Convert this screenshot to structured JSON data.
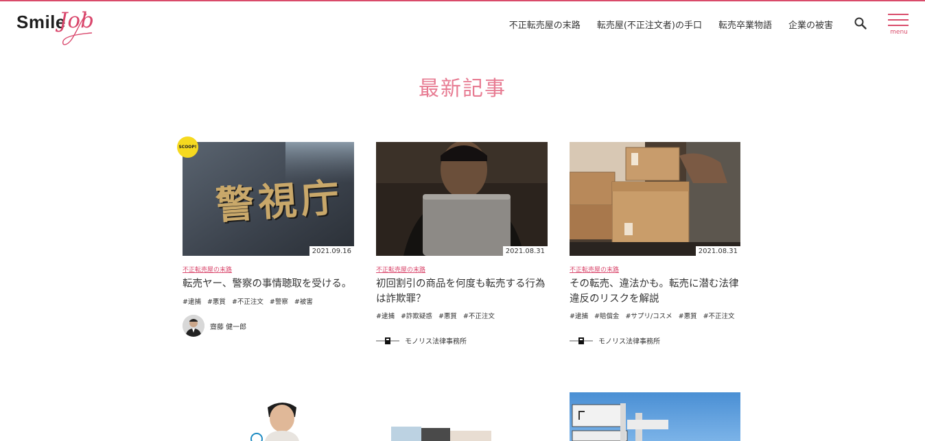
{
  "logo": {
    "text_main": "Smile",
    "text_script": "Job"
  },
  "nav": {
    "items": [
      "不正転売屋の末路",
      "転売屋(不正注文者)の手口",
      "転売卒業物語",
      "企業の被害"
    ],
    "menu_label": "menu",
    "search_icon": "search-icon"
  },
  "section_title": "最新記事",
  "scoop_badge": "SCOOP!",
  "colors": {
    "accent": "#d94b6a",
    "title_pink": "#e77b92"
  },
  "cards": [
    {
      "date": "2021.09.16",
      "category": "不正転売屋の末路",
      "title": "転売ヤー、警察の事情聴取を受ける。",
      "tags": [
        "#逮捕",
        "#悪質",
        "#不正注文",
        "#警察",
        "#被害"
      ],
      "author": "齋藤 健一郎",
      "image_text": "警視庁"
    },
    {
      "date": "2021.08.31",
      "category": "不正転売屋の末路",
      "title": "初回割引の商品を何度も転売する行為は詐欺罪？",
      "tags": [
        "#逮捕",
        "#詐欺疑惑",
        "#悪質",
        "#不正注文"
      ],
      "author": "モノリス法律事務所"
    },
    {
      "date": "2021.08.31",
      "category": "不正転売屋の末路",
      "title": "その転売、違法かも。転売に潜む法律違反のリスクを解説",
      "tags": [
        "#逮捕",
        "#賠償金",
        "#サプリ/コスメ",
        "#悪質",
        "#不正注文"
      ],
      "author": "モノリス法律事務所"
    }
  ]
}
